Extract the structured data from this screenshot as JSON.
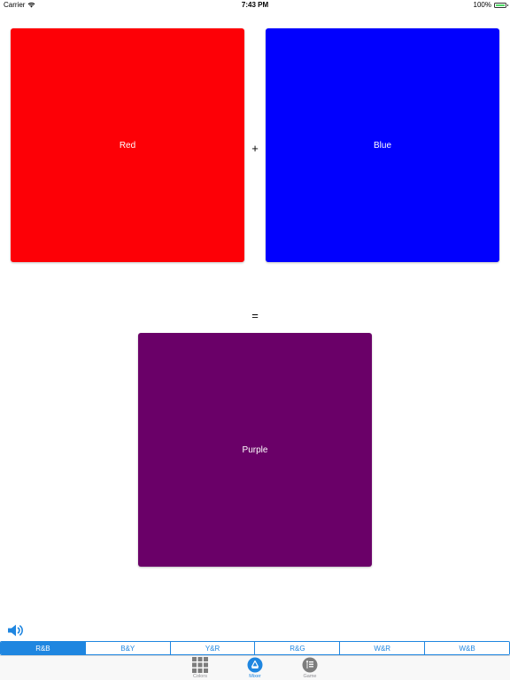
{
  "status_bar": {
    "carrier": "Carrier",
    "time": "7:43 PM",
    "battery": "100%",
    "battery_color": "#4cd964"
  },
  "mixer": {
    "left": {
      "label": "Red",
      "color": "#fd0006"
    },
    "operator_plus": "+",
    "right": {
      "label": "Blue",
      "color": "#0100fe"
    },
    "operator_equals": "=",
    "result": {
      "label": "Purple",
      "color": "#6a0068"
    }
  },
  "speaker_icon": "speaker-volume-icon",
  "combos": [
    {
      "label": "R&B",
      "selected": true
    },
    {
      "label": "B&Y",
      "selected": false
    },
    {
      "label": "Y&R",
      "selected": false
    },
    {
      "label": "R&G",
      "selected": false
    },
    {
      "label": "W&R",
      "selected": false
    },
    {
      "label": "W&B",
      "selected": false
    }
  ],
  "tabs": [
    {
      "label": "Colors",
      "icon": "grid-icon",
      "active": false
    },
    {
      "label": "Mixer",
      "icon": "mixer-icon",
      "active": true
    },
    {
      "label": "Game",
      "icon": "game-icon",
      "active": false
    }
  ],
  "accent_color": "#1f86e0"
}
